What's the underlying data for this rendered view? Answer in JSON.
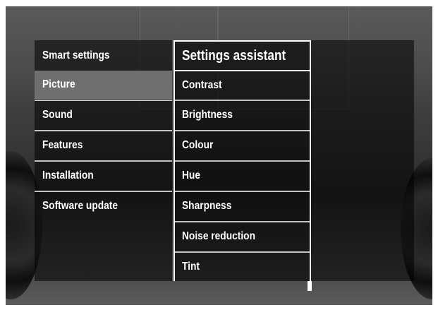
{
  "menu": {
    "items": [
      {
        "label": "Smart settings",
        "selected": false
      },
      {
        "label": "Picture",
        "selected": true
      },
      {
        "label": "Sound",
        "selected": false
      },
      {
        "label": "Features",
        "selected": false
      },
      {
        "label": "Installation",
        "selected": false
      },
      {
        "label": "Software update",
        "selected": false
      }
    ]
  },
  "submenu": {
    "items": [
      {
        "label": "Settings assistant",
        "highlighted": true
      },
      {
        "label": "Contrast",
        "highlighted": false
      },
      {
        "label": "Brightness",
        "highlighted": false
      },
      {
        "label": "Colour",
        "highlighted": false
      },
      {
        "label": "Hue",
        "highlighted": false
      },
      {
        "label": "Sharpness",
        "highlighted": false
      },
      {
        "label": "Noise reduction",
        "highlighted": false
      },
      {
        "label": "Tint",
        "highlighted": false
      }
    ]
  },
  "colors": {
    "selected_background": "#6f6f6f",
    "highlight_border": "#ffffff",
    "text": "#ffffff"
  }
}
